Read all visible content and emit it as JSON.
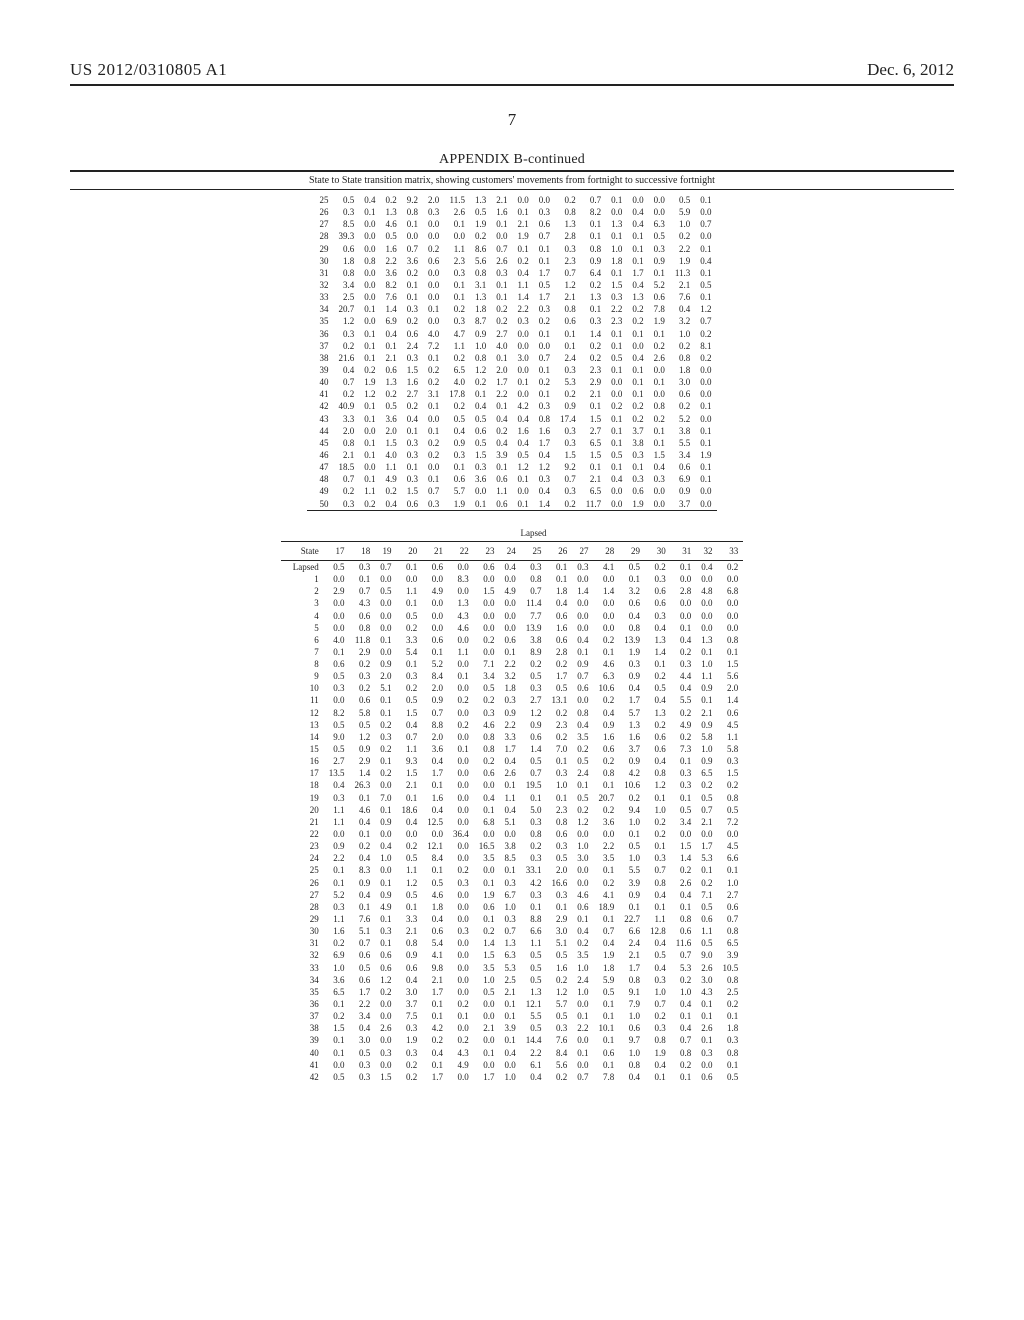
{
  "header": {
    "left": "US 2012/0310805 A1",
    "right": "Dec. 6, 2012"
  },
  "pagenum": "7",
  "appendix": {
    "title": "APPENDIX B-continued",
    "subtitle": "State to State transition matrix, showing customers' movements from fortnight to successive fortnight"
  },
  "table1_rows": [
    [
      "25",
      "0.5",
      "0.4",
      "0.2",
      "9.2",
      "2.0",
      "11.5",
      "1.3",
      "2.1",
      "0.0",
      "0.0",
      "0.2",
      "0.7",
      "0.1",
      "0.0",
      "0.0",
      "0.5",
      "0.1"
    ],
    [
      "26",
      "0.3",
      "0.1",
      "1.3",
      "0.8",
      "0.3",
      "2.6",
      "0.5",
      "1.6",
      "0.1",
      "0.3",
      "0.8",
      "8.2",
      "0.0",
      "0.4",
      "0.0",
      "5.9",
      "0.0"
    ],
    [
      "27",
      "8.5",
      "0.0",
      "4.6",
      "0.1",
      "0.0",
      "0.1",
      "1.9",
      "0.1",
      "2.1",
      "0.6",
      "1.3",
      "0.1",
      "1.3",
      "0.4",
      "6.3",
      "1.0",
      "0.7"
    ],
    [
      "28",
      "39.3",
      "0.0",
      "0.5",
      "0.0",
      "0.0",
      "0.0",
      "0.2",
      "0.0",
      "1.9",
      "0.7",
      "2.8",
      "0.1",
      "0.1",
      "0.1",
      "0.5",
      "0.2",
      "0.0"
    ],
    [
      "29",
      "0.6",
      "0.0",
      "1.6",
      "0.7",
      "0.2",
      "1.1",
      "8.6",
      "0.7",
      "0.1",
      "0.1",
      "0.3",
      "0.8",
      "1.0",
      "0.1",
      "0.3",
      "2.2",
      "0.1"
    ],
    [
      "30",
      "1.8",
      "0.8",
      "2.2",
      "3.6",
      "0.6",
      "2.3",
      "5.6",
      "2.6",
      "0.2",
      "0.1",
      "2.3",
      "0.9",
      "1.8",
      "0.1",
      "0.9",
      "1.9",
      "0.4"
    ],
    [
      "31",
      "0.8",
      "0.0",
      "3.6",
      "0.2",
      "0.0",
      "0.3",
      "0.8",
      "0.3",
      "0.4",
      "1.7",
      "0.7",
      "6.4",
      "0.1",
      "1.7",
      "0.1",
      "11.3",
      "0.1"
    ],
    [
      "32",
      "3.4",
      "0.0",
      "8.2",
      "0.1",
      "0.0",
      "0.1",
      "3.1",
      "0.1",
      "1.1",
      "0.5",
      "1.2",
      "0.2",
      "1.5",
      "0.4",
      "5.2",
      "2.1",
      "0.5"
    ],
    [
      "33",
      "2.5",
      "0.0",
      "7.6",
      "0.1",
      "0.0",
      "0.1",
      "1.3",
      "0.1",
      "1.4",
      "1.7",
      "2.1",
      "1.3",
      "0.3",
      "1.3",
      "0.6",
      "7.6",
      "0.1"
    ],
    [
      "34",
      "20.7",
      "0.1",
      "1.4",
      "0.3",
      "0.1",
      "0.2",
      "1.8",
      "0.2",
      "2.2",
      "0.3",
      "0.8",
      "0.1",
      "2.2",
      "0.2",
      "7.8",
      "0.4",
      "1.2"
    ],
    [
      "35",
      "1.2",
      "0.0",
      "6.9",
      "0.2",
      "0.0",
      "0.3",
      "8.7",
      "0.2",
      "0.3",
      "0.2",
      "0.6",
      "0.3",
      "2.3",
      "0.2",
      "1.9",
      "3.2",
      "0.7"
    ],
    [
      "36",
      "0.3",
      "0.1",
      "0.4",
      "0.6",
      "4.0",
      "4.7",
      "0.9",
      "2.7",
      "0.0",
      "0.1",
      "0.1",
      "1.4",
      "0.1",
      "0.1",
      "0.1",
      "1.0",
      "0.2"
    ],
    [
      "37",
      "0.2",
      "0.1",
      "0.1",
      "2.4",
      "7.2",
      "1.1",
      "1.0",
      "4.0",
      "0.0",
      "0.0",
      "0.1",
      "0.2",
      "0.1",
      "0.0",
      "0.2",
      "0.2",
      "8.1"
    ],
    [
      "38",
      "21.6",
      "0.1",
      "2.1",
      "0.3",
      "0.1",
      "0.2",
      "0.8",
      "0.1",
      "3.0",
      "0.7",
      "2.4",
      "0.2",
      "0.5",
      "0.4",
      "2.6",
      "0.8",
      "0.2"
    ],
    [
      "39",
      "0.4",
      "0.2",
      "0.6",
      "1.5",
      "0.2",
      "6.5",
      "1.2",
      "2.0",
      "0.0",
      "0.1",
      "0.3",
      "2.3",
      "0.1",
      "0.1",
      "0.0",
      "1.8",
      "0.0"
    ],
    [
      "40",
      "0.7",
      "1.9",
      "1.3",
      "1.6",
      "0.2",
      "4.0",
      "0.2",
      "1.7",
      "0.1",
      "0.2",
      "5.3",
      "2.9",
      "0.0",
      "0.1",
      "0.1",
      "3.0",
      "0.0"
    ],
    [
      "41",
      "0.2",
      "1.2",
      "0.2",
      "2.7",
      "3.1",
      "17.8",
      "0.1",
      "2.2",
      "0.0",
      "0.1",
      "0.2",
      "2.1",
      "0.0",
      "0.1",
      "0.0",
      "0.6",
      "0.0"
    ],
    [
      "42",
      "40.9",
      "0.1",
      "0.5",
      "0.2",
      "0.1",
      "0.2",
      "0.4",
      "0.1",
      "4.2",
      "0.3",
      "0.9",
      "0.1",
      "0.2",
      "0.2",
      "0.8",
      "0.2",
      "0.1"
    ],
    [
      "43",
      "3.3",
      "0.1",
      "3.6",
      "0.4",
      "0.0",
      "0.5",
      "0.5",
      "0.4",
      "0.4",
      "0.8",
      "17.4",
      "1.5",
      "0.1",
      "0.2",
      "0.2",
      "5.2",
      "0.0"
    ],
    [
      "44",
      "2.0",
      "0.0",
      "2.0",
      "0.1",
      "0.1",
      "0.4",
      "0.6",
      "0.2",
      "1.6",
      "1.6",
      "0.3",
      "2.7",
      "0.1",
      "3.7",
      "0.1",
      "3.8",
      "0.1"
    ],
    [
      "45",
      "0.8",
      "0.1",
      "1.5",
      "0.3",
      "0.2",
      "0.9",
      "0.5",
      "0.4",
      "0.4",
      "1.7",
      "0.3",
      "6.5",
      "0.1",
      "3.8",
      "0.1",
      "5.5",
      "0.1"
    ],
    [
      "46",
      "2.1",
      "0.1",
      "4.0",
      "0.3",
      "0.2",
      "0.3",
      "1.5",
      "3.9",
      "0.5",
      "0.4",
      "1.5",
      "1.5",
      "0.5",
      "0.3",
      "1.5",
      "3.4",
      "1.9"
    ],
    [
      "47",
      "18.5",
      "0.0",
      "1.1",
      "0.1",
      "0.0",
      "0.1",
      "0.3",
      "0.1",
      "1.2",
      "1.2",
      "9.2",
      "0.1",
      "0.1",
      "0.1",
      "0.4",
      "0.6",
      "0.1"
    ],
    [
      "48",
      "0.7",
      "0.1",
      "4.9",
      "0.3",
      "0.1",
      "0.6",
      "3.6",
      "0.6",
      "0.1",
      "0.3",
      "0.7",
      "2.1",
      "0.4",
      "0.3",
      "0.3",
      "6.9",
      "0.1"
    ],
    [
      "49",
      "0.2",
      "1.1",
      "0.2",
      "1.5",
      "0.7",
      "5.7",
      "0.0",
      "1.1",
      "0.0",
      "0.4",
      "0.3",
      "6.5",
      "0.0",
      "0.6",
      "0.0",
      "0.9",
      "0.0"
    ],
    [
      "50",
      "0.3",
      "0.2",
      "0.4",
      "0.6",
      "0.3",
      "1.9",
      "0.1",
      "0.6",
      "0.1",
      "1.4",
      "0.2",
      "11.7",
      "0.0",
      "1.9",
      "0.0",
      "3.7",
      "0.0"
    ]
  ],
  "table2_group_label": "Lapsed",
  "table2_state_label": "State",
  "table2_cols": [
    "17",
    "18",
    "19",
    "20",
    "21",
    "22",
    "23",
    "24",
    "25",
    "26",
    "27",
    "28",
    "29",
    "30",
    "31",
    "32",
    "33"
  ],
  "table2_rows": [
    [
      "Lapsed",
      "0.5",
      "0.3",
      "0.7",
      "0.1",
      "0.6",
      "0.0",
      "0.6",
      "0.4",
      "0.3",
      "0.1",
      "0.3",
      "4.1",
      "0.5",
      "0.2",
      "0.1",
      "0.4",
      "0.2"
    ],
    [
      "1",
      "0.0",
      "0.1",
      "0.0",
      "0.0",
      "0.0",
      "8.3",
      "0.0",
      "0.0",
      "0.8",
      "0.1",
      "0.0",
      "0.0",
      "0.1",
      "0.3",
      "0.0",
      "0.0",
      "0.0"
    ],
    [
      "2",
      "2.9",
      "0.7",
      "0.5",
      "1.1",
      "4.9",
      "0.0",
      "1.5",
      "4.9",
      "0.7",
      "1.8",
      "1.4",
      "1.4",
      "3.2",
      "0.6",
      "2.8",
      "4.8",
      "6.8"
    ],
    [
      "3",
      "0.0",
      "4.3",
      "0.0",
      "0.1",
      "0.0",
      "1.3",
      "0.0",
      "0.0",
      "11.4",
      "0.4",
      "0.0",
      "0.0",
      "0.6",
      "0.6",
      "0.0",
      "0.0",
      "0.0"
    ],
    [
      "4",
      "0.0",
      "0.6",
      "0.0",
      "0.5",
      "0.0",
      "4.3",
      "0.0",
      "0.0",
      "7.7",
      "0.6",
      "0.0",
      "0.0",
      "0.4",
      "0.3",
      "0.0",
      "0.0",
      "0.0"
    ],
    [
      "5",
      "0.0",
      "0.8",
      "0.0",
      "0.2",
      "0.0",
      "4.6",
      "0.0",
      "0.0",
      "13.9",
      "1.6",
      "0.0",
      "0.0",
      "0.8",
      "0.4",
      "0.1",
      "0.0",
      "0.0"
    ],
    [
      "6",
      "4.0",
      "11.8",
      "0.1",
      "3.3",
      "0.6",
      "0.0",
      "0.2",
      "0.6",
      "3.8",
      "0.6",
      "0.4",
      "0.2",
      "13.9",
      "1.3",
      "0.4",
      "1.3",
      "0.8"
    ],
    [
      "7",
      "0.1",
      "2.9",
      "0.0",
      "5.4",
      "0.1",
      "1.1",
      "0.0",
      "0.1",
      "8.9",
      "2.8",
      "0.1",
      "0.1",
      "1.9",
      "1.4",
      "0.2",
      "0.1",
      "0.1"
    ],
    [
      "8",
      "0.6",
      "0.2",
      "0.9",
      "0.1",
      "5.2",
      "0.0",
      "7.1",
      "2.2",
      "0.2",
      "0.2",
      "0.9",
      "4.6",
      "0.3",
      "0.1",
      "0.3",
      "1.0",
      "1.5"
    ],
    [
      "9",
      "0.5",
      "0.3",
      "2.0",
      "0.3",
      "8.4",
      "0.1",
      "3.4",
      "3.2",
      "0.5",
      "1.7",
      "0.7",
      "6.3",
      "0.9",
      "0.2",
      "4.4",
      "1.1",
      "5.6"
    ],
    [
      "10",
      "0.3",
      "0.2",
      "5.1",
      "0.2",
      "2.0",
      "0.0",
      "0.5",
      "1.8",
      "0.3",
      "0.5",
      "0.6",
      "10.6",
      "0.4",
      "0.5",
      "0.4",
      "0.9",
      "2.0"
    ],
    [
      "11",
      "0.0",
      "0.6",
      "0.1",
      "0.5",
      "0.9",
      "0.2",
      "0.2",
      "0.3",
      "2.7",
      "13.1",
      "0.0",
      "0.2",
      "1.7",
      "0.4",
      "5.5",
      "0.1",
      "1.4"
    ],
    [
      "12",
      "8.2",
      "5.8",
      "0.1",
      "1.5",
      "0.7",
      "0.0",
      "0.3",
      "0.9",
      "1.2",
      "0.2",
      "0.8",
      "0.4",
      "5.7",
      "1.3",
      "0.2",
      "2.1",
      "0.6"
    ],
    [
      "13",
      "0.5",
      "0.5",
      "0.2",
      "0.4",
      "8.8",
      "0.2",
      "4.6",
      "2.2",
      "0.9",
      "2.3",
      "0.4",
      "0.9",
      "1.3",
      "0.2",
      "4.9",
      "0.9",
      "4.5"
    ],
    [
      "14",
      "9.0",
      "1.2",
      "0.3",
      "0.7",
      "2.0",
      "0.0",
      "0.8",
      "3.3",
      "0.6",
      "0.2",
      "3.5",
      "1.6",
      "1.6",
      "0.6",
      "0.2",
      "5.8",
      "1.1"
    ],
    [
      "15",
      "0.5",
      "0.9",
      "0.2",
      "1.1",
      "3.6",
      "0.1",
      "0.8",
      "1.7",
      "1.4",
      "7.0",
      "0.2",
      "0.6",
      "3.7",
      "0.6",
      "7.3",
      "1.0",
      "5.8"
    ],
    [
      "16",
      "2.7",
      "2.9",
      "0.1",
      "9.3",
      "0.4",
      "0.0",
      "0.2",
      "0.4",
      "0.5",
      "0.1",
      "0.5",
      "0.2",
      "0.9",
      "0.4",
      "0.1",
      "0.9",
      "0.3"
    ],
    [
      "17",
      "13.5",
      "1.4",
      "0.2",
      "1.5",
      "1.7",
      "0.0",
      "0.6",
      "2.6",
      "0.7",
      "0.3",
      "2.4",
      "0.8",
      "4.2",
      "0.8",
      "0.3",
      "6.5",
      "1.5"
    ],
    [
      "18",
      "0.4",
      "26.3",
      "0.0",
      "2.1",
      "0.1",
      "0.0",
      "0.0",
      "0.1",
      "19.5",
      "1.0",
      "0.1",
      "0.1",
      "10.6",
      "1.2",
      "0.3",
      "0.2",
      "0.2"
    ],
    [
      "19",
      "0.3",
      "0.1",
      "7.0",
      "0.1",
      "1.6",
      "0.0",
      "0.4",
      "1.1",
      "0.1",
      "0.1",
      "0.5",
      "20.7",
      "0.2",
      "0.1",
      "0.1",
      "0.5",
      "0.8"
    ],
    [
      "20",
      "1.1",
      "4.6",
      "0.1",
      "18.6",
      "0.4",
      "0.0",
      "0.1",
      "0.4",
      "5.0",
      "2.3",
      "0.2",
      "0.2",
      "9.4",
      "1.0",
      "0.5",
      "0.7",
      "0.5"
    ],
    [
      "21",
      "1.1",
      "0.4",
      "0.9",
      "0.4",
      "12.5",
      "0.0",
      "6.8",
      "5.1",
      "0.3",
      "0.8",
      "1.2",
      "3.6",
      "1.0",
      "0.2",
      "3.4",
      "2.1",
      "7.2"
    ],
    [
      "22",
      "0.0",
      "0.1",
      "0.0",
      "0.0",
      "0.0",
      "36.4",
      "0.0",
      "0.0",
      "0.8",
      "0.6",
      "0.0",
      "0.0",
      "0.1",
      "0.2",
      "0.0",
      "0.0",
      "0.0"
    ],
    [
      "23",
      "0.9",
      "0.2",
      "0.4",
      "0.2",
      "12.1",
      "0.0",
      "16.5",
      "3.8",
      "0.2",
      "0.3",
      "1.0",
      "2.2",
      "0.5",
      "0.1",
      "1.5",
      "1.7",
      "4.5"
    ],
    [
      "24",
      "2.2",
      "0.4",
      "1.0",
      "0.5",
      "8.4",
      "0.0",
      "3.5",
      "8.5",
      "0.3",
      "0.5",
      "3.0",
      "3.5",
      "1.0",
      "0.3",
      "1.4",
      "5.3",
      "6.6"
    ],
    [
      "25",
      "0.1",
      "8.3",
      "0.0",
      "1.1",
      "0.1",
      "0.2",
      "0.0",
      "0.1",
      "33.1",
      "2.0",
      "0.0",
      "0.1",
      "5.5",
      "0.7",
      "0.2",
      "0.1",
      "0.1"
    ],
    [
      "26",
      "0.1",
      "0.9",
      "0.1",
      "1.2",
      "0.5",
      "0.3",
      "0.1",
      "0.3",
      "4.2",
      "16.6",
      "0.0",
      "0.2",
      "3.9",
      "0.8",
      "2.6",
      "0.2",
      "1.0"
    ],
    [
      "27",
      "5.2",
      "0.4",
      "0.9",
      "0.5",
      "4.6",
      "0.0",
      "1.9",
      "6.7",
      "0.3",
      "0.3",
      "4.6",
      "4.1",
      "0.9",
      "0.4",
      "0.4",
      "7.1",
      "2.7"
    ],
    [
      "28",
      "0.3",
      "0.1",
      "4.9",
      "0.1",
      "1.8",
      "0.0",
      "0.6",
      "1.0",
      "0.1",
      "0.1",
      "0.6",
      "18.9",
      "0.1",
      "0.1",
      "0.1",
      "0.5",
      "0.6"
    ],
    [
      "29",
      "1.1",
      "7.6",
      "0.1",
      "3.3",
      "0.4",
      "0.0",
      "0.1",
      "0.3",
      "8.8",
      "2.9",
      "0.1",
      "0.1",
      "22.7",
      "1.1",
      "0.8",
      "0.6",
      "0.7"
    ],
    [
      "30",
      "1.6",
      "5.1",
      "0.3",
      "2.1",
      "0.6",
      "0.3",
      "0.2",
      "0.7",
      "6.6",
      "3.0",
      "0.4",
      "0.7",
      "6.6",
      "12.8",
      "0.6",
      "1.1",
      "0.8"
    ],
    [
      "31",
      "0.2",
      "0.7",
      "0.1",
      "0.8",
      "5.4",
      "0.0",
      "1.4",
      "1.3",
      "1.1",
      "5.1",
      "0.2",
      "0.4",
      "2.4",
      "0.4",
      "11.6",
      "0.5",
      "6.5"
    ],
    [
      "32",
      "6.9",
      "0.6",
      "0.6",
      "0.9",
      "4.1",
      "0.0",
      "1.5",
      "6.3",
      "0.5",
      "0.5",
      "3.5",
      "1.9",
      "2.1",
      "0.5",
      "0.7",
      "9.0",
      "3.9"
    ],
    [
      "33",
      "1.0",
      "0.5",
      "0.6",
      "0.6",
      "9.8",
      "0.0",
      "3.5",
      "5.3",
      "0.5",
      "1.6",
      "1.0",
      "1.8",
      "1.7",
      "0.4",
      "5.3",
      "2.6",
      "10.5"
    ],
    [
      "34",
      "3.6",
      "0.6",
      "1.2",
      "0.4",
      "2.1",
      "0.0",
      "1.0",
      "2.5",
      "0.5",
      "0.2",
      "2.4",
      "5.9",
      "0.8",
      "0.3",
      "0.2",
      "3.0",
      "0.8"
    ],
    [
      "35",
      "6.5",
      "1.7",
      "0.2",
      "3.0",
      "1.7",
      "0.0",
      "0.5",
      "2.1",
      "1.3",
      "1.2",
      "1.0",
      "0.5",
      "9.1",
      "1.0",
      "1.0",
      "4.3",
      "2.5"
    ],
    [
      "36",
      "0.1",
      "2.2",
      "0.0",
      "3.7",
      "0.1",
      "0.2",
      "0.0",
      "0.1",
      "12.1",
      "5.7",
      "0.0",
      "0.1",
      "7.9",
      "0.7",
      "0.4",
      "0.1",
      "0.2"
    ],
    [
      "37",
      "0.2",
      "3.4",
      "0.0",
      "7.5",
      "0.1",
      "0.1",
      "0.0",
      "0.1",
      "5.5",
      "0.5",
      "0.1",
      "0.1",
      "1.0",
      "0.2",
      "0.1",
      "0.1",
      "0.1"
    ],
    [
      "38",
      "1.5",
      "0.4",
      "2.6",
      "0.3",
      "4.2",
      "0.0",
      "2.1",
      "3.9",
      "0.5",
      "0.3",
      "2.2",
      "10.1",
      "0.6",
      "0.3",
      "0.4",
      "2.6",
      "1.8"
    ],
    [
      "39",
      "0.1",
      "3.0",
      "0.0",
      "1.9",
      "0.2",
      "0.2",
      "0.0",
      "0.1",
      "14.4",
      "7.6",
      "0.0",
      "0.1",
      "9.7",
      "0.8",
      "0.7",
      "0.1",
      "0.3"
    ],
    [
      "40",
      "0.1",
      "0.5",
      "0.3",
      "0.3",
      "0.4",
      "4.3",
      "0.1",
      "0.4",
      "2.2",
      "8.4",
      "0.1",
      "0.6",
      "1.0",
      "1.9",
      "0.8",
      "0.3",
      "0.8"
    ],
    [
      "41",
      "0.0",
      "0.3",
      "0.0",
      "0.2",
      "0.1",
      "4.9",
      "0.0",
      "0.0",
      "6.1",
      "5.6",
      "0.0",
      "0.1",
      "0.8",
      "0.4",
      "0.2",
      "0.0",
      "0.1"
    ],
    [
      "42",
      "0.5",
      "0.3",
      "1.5",
      "0.2",
      "1.7",
      "0.0",
      "1.7",
      "1.0",
      "0.4",
      "0.2",
      "0.7",
      "7.8",
      "0.4",
      "0.1",
      "0.1",
      "0.6",
      "0.5"
    ]
  ]
}
